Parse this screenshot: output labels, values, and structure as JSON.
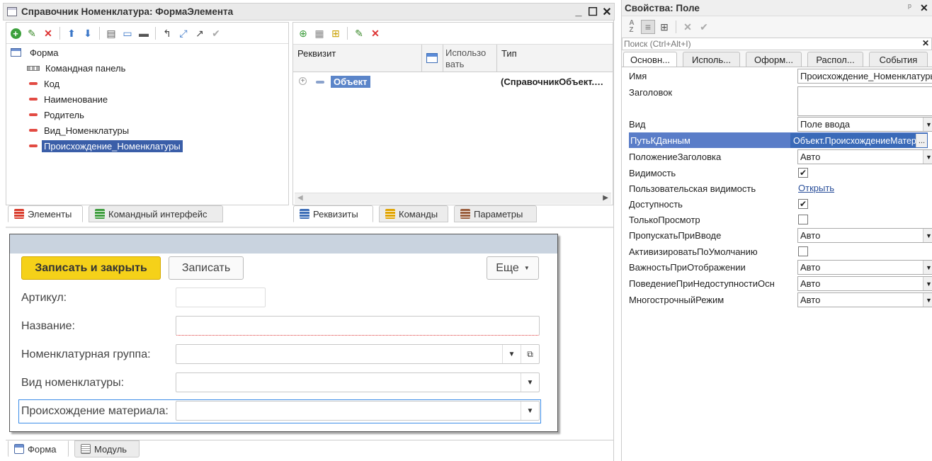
{
  "designer": {
    "title": "Справочник Номенклатура: ФормаЭлемента",
    "win_min": "_",
    "win_max": "☐",
    "win_close": "✕",
    "tree_root": "Форма",
    "tree_items": [
      "Командная панель",
      "Код",
      "Наименование",
      "Родитель",
      "Вид_Номенклатуры",
      "Происхождение_Номенклатуры"
    ],
    "left_tabs": [
      "Элементы",
      "Командный интерфейс"
    ],
    "attr_columns": {
      "rekvizit": "Реквизит",
      "use": "Использо\nвать",
      "type": "Тип"
    },
    "attr_row": {
      "name": "Объект",
      "type": "(СправочникОбъект.…"
    },
    "mid_tabs": [
      "Реквизиты",
      "Команды",
      "Параметры"
    ],
    "bottom_tabs": [
      "Форма",
      "Модуль"
    ]
  },
  "preview": {
    "save_close": "Записать и закрыть",
    "save": "Записать",
    "more": "Еще",
    "fields": [
      "Артикул:",
      "Название:",
      "Номенклатурная группа:",
      "Вид номенклатуры:",
      "Происхождение материала:"
    ]
  },
  "props": {
    "title": "Свойства: Поле",
    "pin": "ᵖ",
    "close": "✕",
    "search_placeholder": "Поиск (Ctrl+Alt+I)",
    "tabs": [
      "Основн...",
      "Исполь...",
      "Оформ...",
      "Распол...",
      "События"
    ],
    "rows": [
      {
        "label": "Имя",
        "value": "Происхождение_Номенклатуры"
      },
      {
        "label": "Заголовок",
        "value": ""
      },
      {
        "label": "Вид",
        "value": "Поле ввода"
      },
      {
        "label": "ПутьКДанным",
        "value": "Объект.ПроисхождениеМатериала"
      },
      {
        "label": "ПоложениеЗаголовка",
        "value": "Авто"
      },
      {
        "label": "Видимость",
        "value": "✔"
      },
      {
        "label": "Пользовательская видимость",
        "value": "Открыть"
      },
      {
        "label": "Доступность",
        "value": "✔"
      },
      {
        "label": "ТолькоПросмотр",
        "value": ""
      },
      {
        "label": "ПропускатьПриВводе",
        "value": "Авто"
      },
      {
        "label": "АктивизироватьПоУмолчанию",
        "value": ""
      },
      {
        "label": "ВажностьПриОтображении",
        "value": "Авто"
      },
      {
        "label": "ПоведениеПриНедоступностиОсн",
        "value": "Авто"
      },
      {
        "label": "МногострочныйРежим",
        "value": "Авто"
      }
    ],
    "ellipsis": "..."
  },
  "colors": {
    "accent_yellow": "#f5d119",
    "selection": "#3a6ab8",
    "highlight_row": "#5a7dc8"
  }
}
